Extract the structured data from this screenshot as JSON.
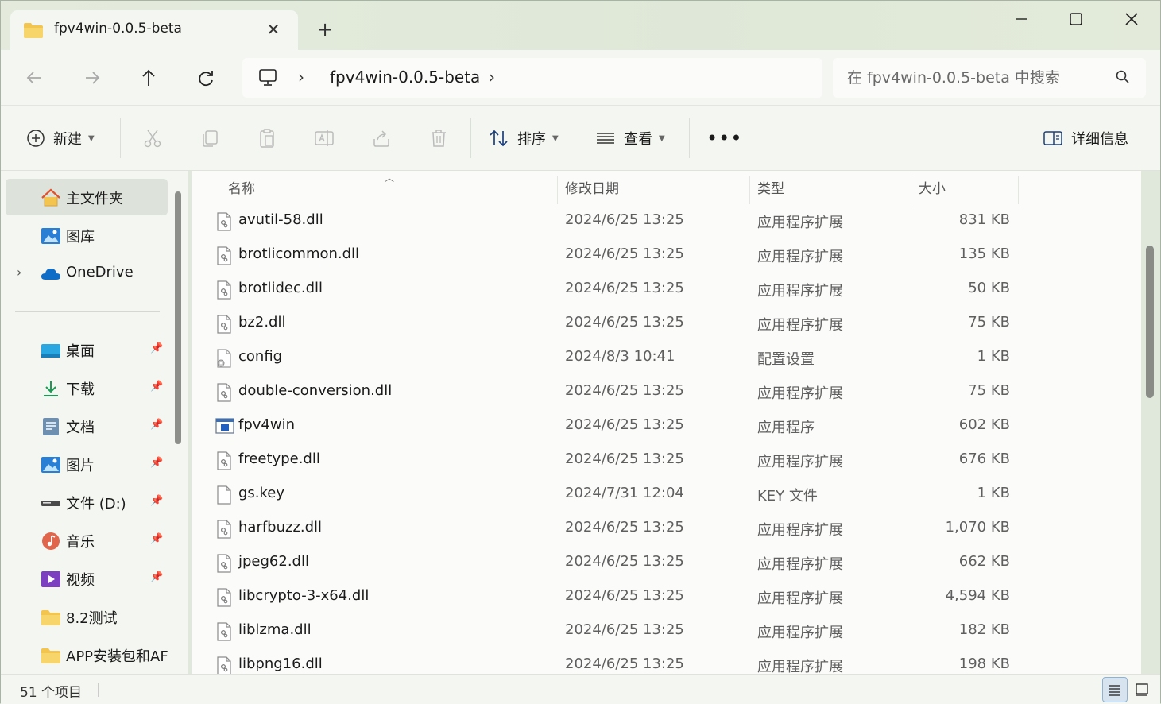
{
  "tab": {
    "title": "fpv4win-0.0.5-beta",
    "close_label": "✕",
    "new_tab_label": "+"
  },
  "window_controls": {
    "minimize": "—",
    "maximize": "☐",
    "close": "✕"
  },
  "address": {
    "breadcrumb": [
      "fpv4win-0.0.5-beta"
    ],
    "separator": "›"
  },
  "search": {
    "placeholder": "在 fpv4win-0.0.5-beta 中搜索"
  },
  "toolbar": {
    "new_label": "新建",
    "sort_label": "排序",
    "view_label": "查看",
    "more_label": "•••",
    "details_label": "详细信息"
  },
  "nav": {
    "items": [
      {
        "label": "主文件夹",
        "icon": "home-icon",
        "active": true,
        "pinned": false
      },
      {
        "label": "图库",
        "icon": "gallery-icon",
        "pinned": false
      },
      {
        "label": "OneDrive",
        "icon": "cloud-icon",
        "pinned": false,
        "expandable": true
      },
      {
        "label": "桌面",
        "icon": "desktop-icon",
        "pinned": true
      },
      {
        "label": "下载",
        "icon": "download-icon",
        "pinned": true
      },
      {
        "label": "文档",
        "icon": "document-icon",
        "pinned": true
      },
      {
        "label": "图片",
        "icon": "picture-icon",
        "pinned": true
      },
      {
        "label": "文件 (D:)",
        "icon": "drive-icon",
        "pinned": true
      },
      {
        "label": "音乐",
        "icon": "music-icon",
        "pinned": true
      },
      {
        "label": "视频",
        "icon": "video-icon",
        "pinned": true
      },
      {
        "label": "8.2测试",
        "icon": "folder-icon",
        "pinned": false
      },
      {
        "label": "APP安装包和AF",
        "icon": "folder-icon",
        "pinned": false
      }
    ]
  },
  "columns": {
    "name": "名称",
    "date": "修改日期",
    "type": "类型",
    "size": "大小"
  },
  "files": [
    {
      "name": "avutil-58.dll",
      "date": "2024/6/25 13:25",
      "type": "应用程序扩展",
      "size": "831 KB",
      "icon": "dll-icon"
    },
    {
      "name": "brotlicommon.dll",
      "date": "2024/6/25 13:25",
      "type": "应用程序扩展",
      "size": "135 KB",
      "icon": "dll-icon"
    },
    {
      "name": "brotlidec.dll",
      "date": "2024/6/25 13:25",
      "type": "应用程序扩展",
      "size": "50 KB",
      "icon": "dll-icon"
    },
    {
      "name": "bz2.dll",
      "date": "2024/6/25 13:25",
      "type": "应用程序扩展",
      "size": "75 KB",
      "icon": "dll-icon"
    },
    {
      "name": "config",
      "date": "2024/8/3 10:41",
      "type": "配置设置",
      "size": "1 KB",
      "icon": "config-icon"
    },
    {
      "name": "double-conversion.dll",
      "date": "2024/6/25 13:25",
      "type": "应用程序扩展",
      "size": "75 KB",
      "icon": "dll-icon"
    },
    {
      "name": "fpv4win",
      "date": "2024/6/25 13:25",
      "type": "应用程序",
      "size": "602 KB",
      "icon": "exe-icon"
    },
    {
      "name": "freetype.dll",
      "date": "2024/6/25 13:25",
      "type": "应用程序扩展",
      "size": "676 KB",
      "icon": "dll-icon"
    },
    {
      "name": "gs.key",
      "date": "2024/7/31 12:04",
      "type": "KEY 文件",
      "size": "1 KB",
      "icon": "blank-file-icon"
    },
    {
      "name": "harfbuzz.dll",
      "date": "2024/6/25 13:25",
      "type": "应用程序扩展",
      "size": "1,070 KB",
      "icon": "dll-icon"
    },
    {
      "name": "jpeg62.dll",
      "date": "2024/6/25 13:25",
      "type": "应用程序扩展",
      "size": "662 KB",
      "icon": "dll-icon"
    },
    {
      "name": "libcrypto-3-x64.dll",
      "date": "2024/6/25 13:25",
      "type": "应用程序扩展",
      "size": "4,594 KB",
      "icon": "dll-icon"
    },
    {
      "name": "liblzma.dll",
      "date": "2024/6/25 13:25",
      "type": "应用程序扩展",
      "size": "182 KB",
      "icon": "dll-icon"
    },
    {
      "name": "libpng16.dll",
      "date": "2024/6/25 13:25",
      "type": "应用程序扩展",
      "size": "198 KB",
      "icon": "dll-icon"
    }
  ],
  "status": {
    "item_count": "51 个项目"
  },
  "colors": {
    "accent": "#0067c0",
    "folder": "#f3c44e",
    "selection": "#dde2da"
  }
}
